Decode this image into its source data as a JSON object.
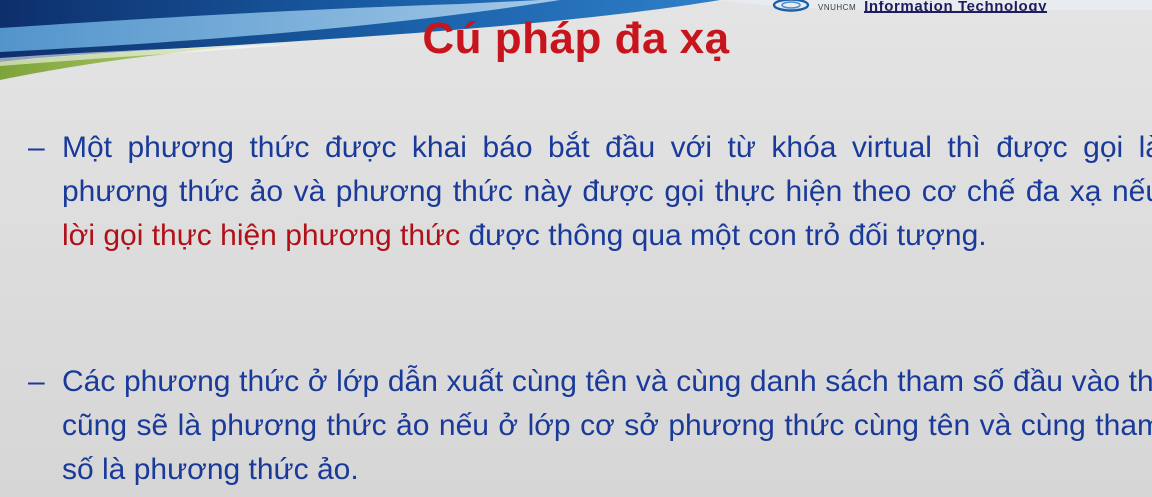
{
  "header": {
    "brand_short": "VNUHCM",
    "brand_long": "Information Technology",
    "accent_color": "#1a5fa8"
  },
  "slide": {
    "title": "Cú pháp đa xạ",
    "title_color": "#c8141c",
    "text_color": "#1a3a9a",
    "highlight_color": "#b01018",
    "bullets": [
      {
        "dash": "–",
        "text_before": "Một phương thức được khai báo bắt đầu với từ khóa virtual thì được gọi là phương thức ảo và phương thức này được gọi thực hiện theo cơ chế đa xạ nếu ",
        "highlight": "lời gọi thực hiện phương thức",
        "text_after": " được thông qua một con trỏ đối tượng."
      },
      {
        "dash": "–",
        "text": "Các phương thức ở lớp dẫn xuất cùng tên và cùng danh sách tham số đầu vào thì cũng sẽ là phương thức ảo nếu ở lớp cơ sở phương thức cùng tên và cùng tham số là phương thức ảo."
      }
    ]
  }
}
